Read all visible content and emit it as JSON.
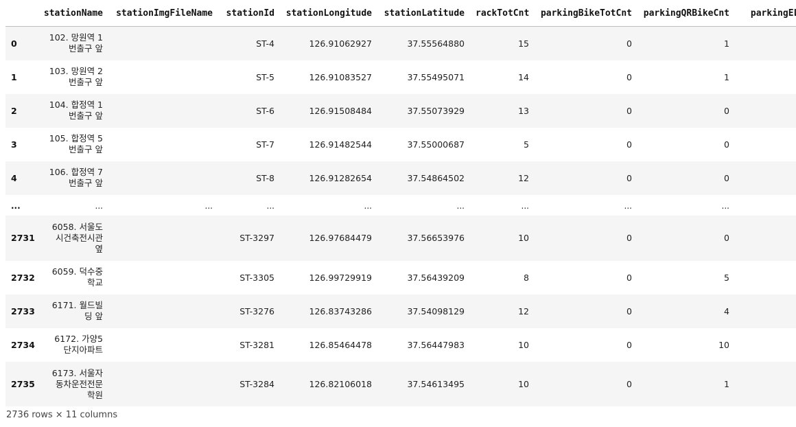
{
  "dataframe": {
    "columns": [
      "",
      "stationName",
      "stationImgFileName",
      "stationId",
      "stationLongitude",
      "stationLatitude",
      "rackTotCnt",
      "parkingBikeTotCnt",
      "parkingQRBikeCnt",
      "parkingELEC"
    ],
    "rows": [
      {
        "index": "0",
        "name_lines": [
          "102. 망원역 1",
          "번출구 앞"
        ],
        "img": "",
        "id": "ST-4",
        "lon": "126.91062927",
        "lat": "37.55564880",
        "rack": "15",
        "park": "0",
        "qr": "1",
        "elec": ""
      },
      {
        "index": "1",
        "name_lines": [
          "103. 망원역 2",
          "번출구 앞"
        ],
        "img": "",
        "id": "ST-5",
        "lon": "126.91083527",
        "lat": "37.55495071",
        "rack": "14",
        "park": "0",
        "qr": "1",
        "elec": ""
      },
      {
        "index": "2",
        "name_lines": [
          "104. 합정역 1",
          "번출구 앞"
        ],
        "img": "",
        "id": "ST-6",
        "lon": "126.91508484",
        "lat": "37.55073929",
        "rack": "13",
        "park": "0",
        "qr": "0",
        "elec": ""
      },
      {
        "index": "3",
        "name_lines": [
          "105. 합정역 5",
          "번출구 앞"
        ],
        "img": "",
        "id": "ST-7",
        "lon": "126.91482544",
        "lat": "37.55000687",
        "rack": "5",
        "park": "0",
        "qr": "0",
        "elec": ""
      },
      {
        "index": "4",
        "name_lines": [
          "106. 합정역 7",
          "번출구 앞"
        ],
        "img": "",
        "id": "ST-8",
        "lon": "126.91282654",
        "lat": "37.54864502",
        "rack": "12",
        "park": "0",
        "qr": "0",
        "elec": ""
      },
      {
        "index": "...",
        "name_lines": [
          "..."
        ],
        "img": "...",
        "id": "...",
        "lon": "...",
        "lat": "...",
        "rack": "...",
        "park": "...",
        "qr": "...",
        "elec": "",
        "ellipsis": true
      },
      {
        "index": "2731",
        "name_lines": [
          "6058. 서울도",
          "시건축전시관",
          "옆"
        ],
        "img": "",
        "id": "ST-3297",
        "lon": "126.97684479",
        "lat": "37.56653976",
        "rack": "10",
        "park": "0",
        "qr": "0",
        "elec": ""
      },
      {
        "index": "2732",
        "name_lines": [
          "6059. 덕수중",
          "학교"
        ],
        "img": "",
        "id": "ST-3305",
        "lon": "126.99729919",
        "lat": "37.56439209",
        "rack": "8",
        "park": "0",
        "qr": "5",
        "elec": ""
      },
      {
        "index": "2733",
        "name_lines": [
          "6171. 월드빌",
          "딩 앞"
        ],
        "img": "",
        "id": "ST-3276",
        "lon": "126.83743286",
        "lat": "37.54098129",
        "rack": "12",
        "park": "0",
        "qr": "4",
        "elec": ""
      },
      {
        "index": "2734",
        "name_lines": [
          "6172. 가양5",
          "단지아파트"
        ],
        "img": "",
        "id": "ST-3281",
        "lon": "126.85464478",
        "lat": "37.56447983",
        "rack": "10",
        "park": "0",
        "qr": "10",
        "elec": ""
      },
      {
        "index": "2735",
        "name_lines": [
          "6173. 서울자",
          "동차운전전문",
          "학원"
        ],
        "img": "",
        "id": "ST-3284",
        "lon": "126.82106018",
        "lat": "37.54613495",
        "rack": "10",
        "park": "0",
        "qr": "1",
        "elec": ""
      }
    ],
    "shape_text": "2736 rows × 11 columns"
  }
}
